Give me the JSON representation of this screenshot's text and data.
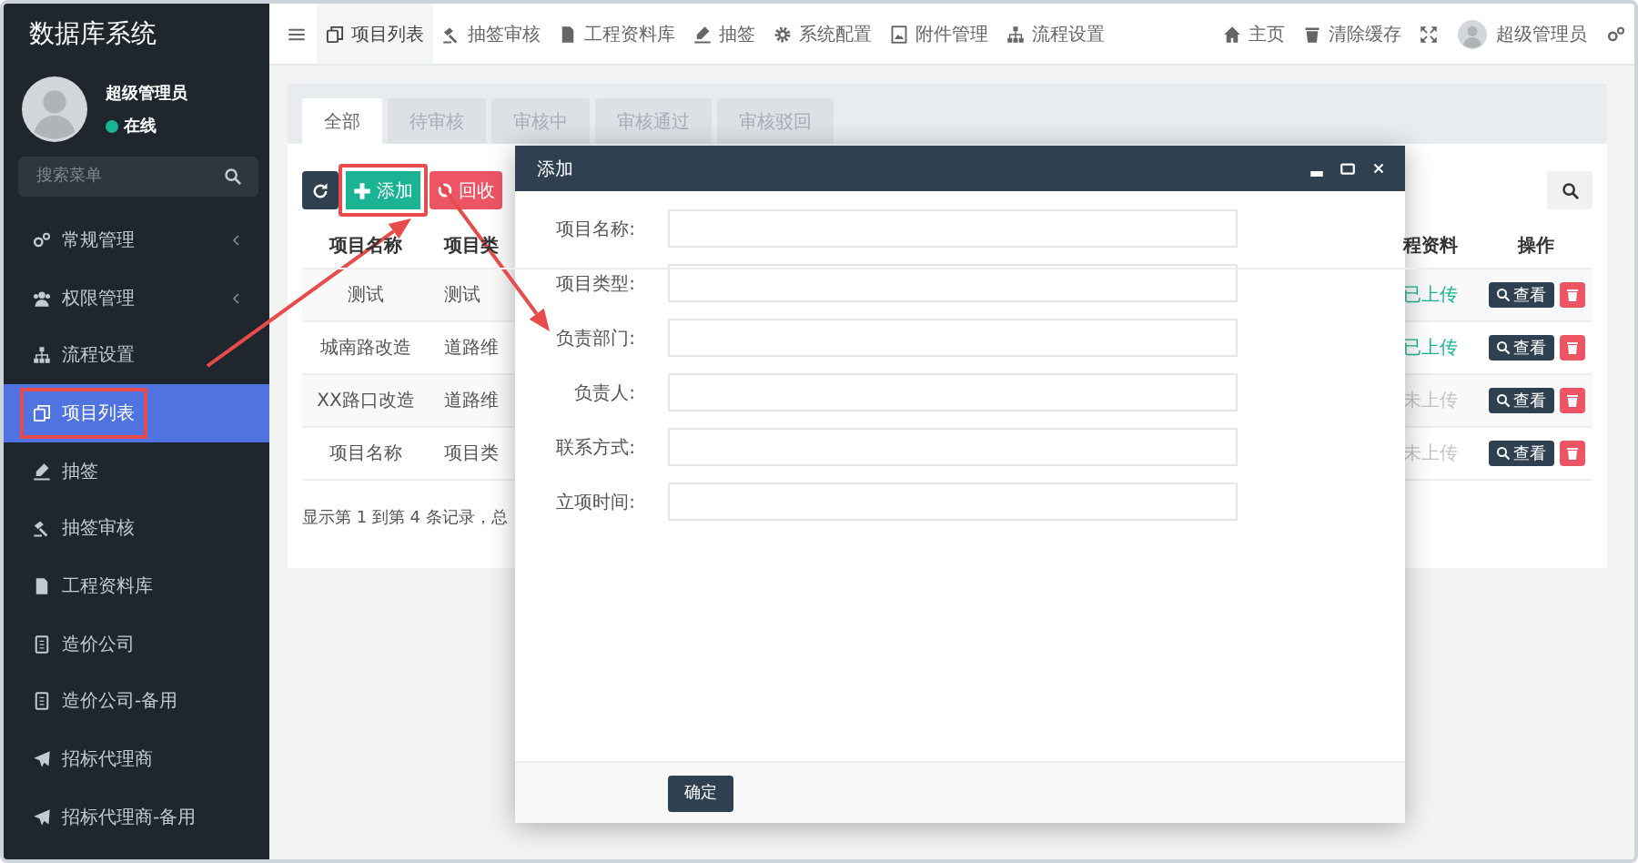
{
  "sidebar": {
    "title": "数据库系统",
    "user": {
      "name": "超级管理员",
      "status": "在线",
      "online": true
    },
    "search": {
      "placeholder": "搜索菜单"
    },
    "items": [
      {
        "label": "常规管理",
        "expandable": true,
        "selected": false,
        "highlighted": false
      },
      {
        "label": "权限管理",
        "expandable": true,
        "selected": false,
        "highlighted": false
      },
      {
        "label": "流程设置",
        "expandable": false,
        "selected": false,
        "highlighted": false
      },
      {
        "label": "项目列表",
        "expandable": false,
        "selected": true,
        "highlighted": true
      },
      {
        "label": "抽签",
        "expandable": false,
        "selected": false,
        "highlighted": false
      },
      {
        "label": "抽签审核",
        "expandable": false,
        "selected": false,
        "highlighted": false
      },
      {
        "label": "工程资料库",
        "expandable": false,
        "selected": false,
        "highlighted": false
      },
      {
        "label": "造价公司",
        "expandable": false,
        "selected": false,
        "highlighted": false
      },
      {
        "label": "造价公司-备用",
        "expandable": false,
        "selected": false,
        "highlighted": false
      },
      {
        "label": "招标代理商",
        "expandable": false,
        "selected": false,
        "highlighted": false
      },
      {
        "label": "招标代理商-备用",
        "expandable": false,
        "selected": false,
        "highlighted": false
      }
    ]
  },
  "topbar": {
    "tabs": [
      {
        "label": "项目列表",
        "selected": true
      },
      {
        "label": "抽签审核",
        "selected": false
      },
      {
        "label": "工程资料库",
        "selected": false
      },
      {
        "label": "抽签",
        "selected": false
      },
      {
        "label": "系统配置",
        "selected": false
      },
      {
        "label": "附件管理",
        "selected": false
      },
      {
        "label": "流程设置",
        "selected": false
      }
    ],
    "links": [
      "主页",
      "清除缓存"
    ],
    "user": "超级管理员"
  },
  "content": {
    "tabs": [
      {
        "label": "全部",
        "selected": true
      },
      {
        "label": "待审核",
        "selected": false
      },
      {
        "label": "审核中",
        "selected": false
      },
      {
        "label": "审核通过",
        "selected": false
      },
      {
        "label": "审核驳回",
        "selected": false
      }
    ],
    "toolbar": [
      {
        "kind": "refresh",
        "highlighted": false
      },
      {
        "kind": "add",
        "label": "添加",
        "highlighted": true
      },
      {
        "kind": "recycle",
        "label": "回收",
        "highlighted": false
      }
    ],
    "table": {
      "columns": [
        "项目名称",
        "项目类",
        "程资料",
        "操作"
      ],
      "rows": [
        {
          "name": "测试",
          "type": "测试",
          "material": "已上传",
          "uploaded": true,
          "action": "查看"
        },
        {
          "name": "城南路改造",
          "type": "道路维",
          "material": "已上传",
          "uploaded": true,
          "action": "查看"
        },
        {
          "name": "XX路口改造",
          "type": "道路维",
          "material": "未上传",
          "uploaded": false,
          "action": "查看"
        },
        {
          "name": "项目名称",
          "type": "项目类",
          "material": "未上传",
          "uploaded": false,
          "action": "查看"
        }
      ]
    },
    "summary": "显示第 1 到第 4 条记录，总"
  },
  "dialog": {
    "title": "添加",
    "fields": [
      {
        "label": "项目名称:"
      },
      {
        "label": "项目类型:"
      },
      {
        "label": "负责部门:"
      },
      {
        "label": "负责人:"
      },
      {
        "label": "联系方式:"
      },
      {
        "label": "立项时间:"
      }
    ],
    "buttons": [
      "确定"
    ]
  }
}
